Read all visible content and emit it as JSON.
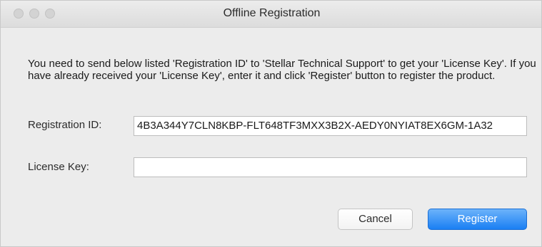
{
  "window": {
    "title": "Offline Registration"
  },
  "message": {
    "text": "You need to send below listed 'Registration ID' to 'Stellar Technical Support' to get your 'License Key'. If you have already received your 'License Key', enter it and click 'Register' button to register the product."
  },
  "registration": {
    "label": "Registration ID:",
    "value": "4B3A344Y7CLN8KBP-FLT648TF3MXX3B2X-AEDY0NYIAT8EX6GM-1A32"
  },
  "license": {
    "label": "License Key:",
    "value": ""
  },
  "buttons": {
    "cancel_label": "Cancel",
    "register_label": "Register"
  },
  "colors": {
    "accent": "#1a7ff3",
    "window_bg": "#ececec"
  }
}
